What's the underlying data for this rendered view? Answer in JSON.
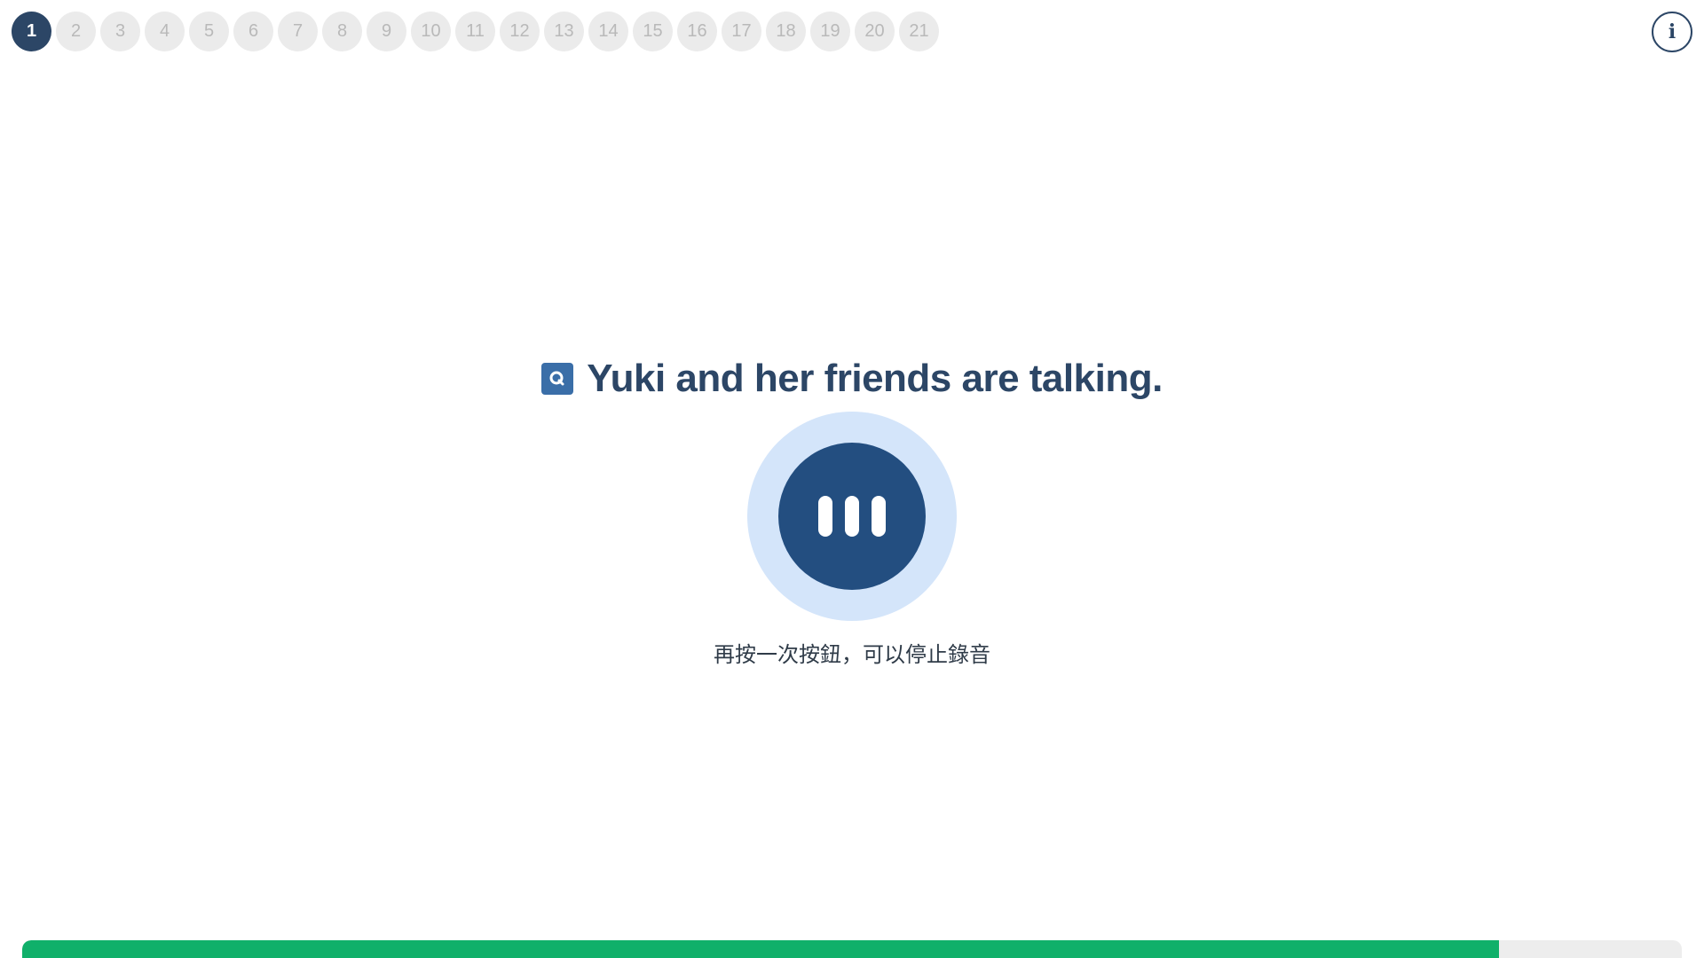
{
  "question_nav": {
    "items": [
      "1",
      "2",
      "3",
      "4",
      "5",
      "6",
      "7",
      "8",
      "9",
      "10",
      "11",
      "12",
      "13",
      "14",
      "15",
      "16",
      "17",
      "18",
      "19",
      "20",
      "21"
    ],
    "active_index": 0
  },
  "info_button": {
    "label": "i",
    "icon": "info-icon"
  },
  "prompt": {
    "icon": "question-q-icon",
    "text": "Yuki and her friends are talking."
  },
  "recorder": {
    "state": "recording",
    "icon": "recording-bars-icon",
    "hint": "再按一次按鈕，可以停止錄音"
  },
  "progress": {
    "fraction": 0.89
  },
  "colors": {
    "accent": "#2c4666",
    "record_button": "#234e80",
    "record_halo": "#d4e5fa",
    "progress_fill": "#10b06a",
    "inactive_dot": "#ebebeb"
  }
}
